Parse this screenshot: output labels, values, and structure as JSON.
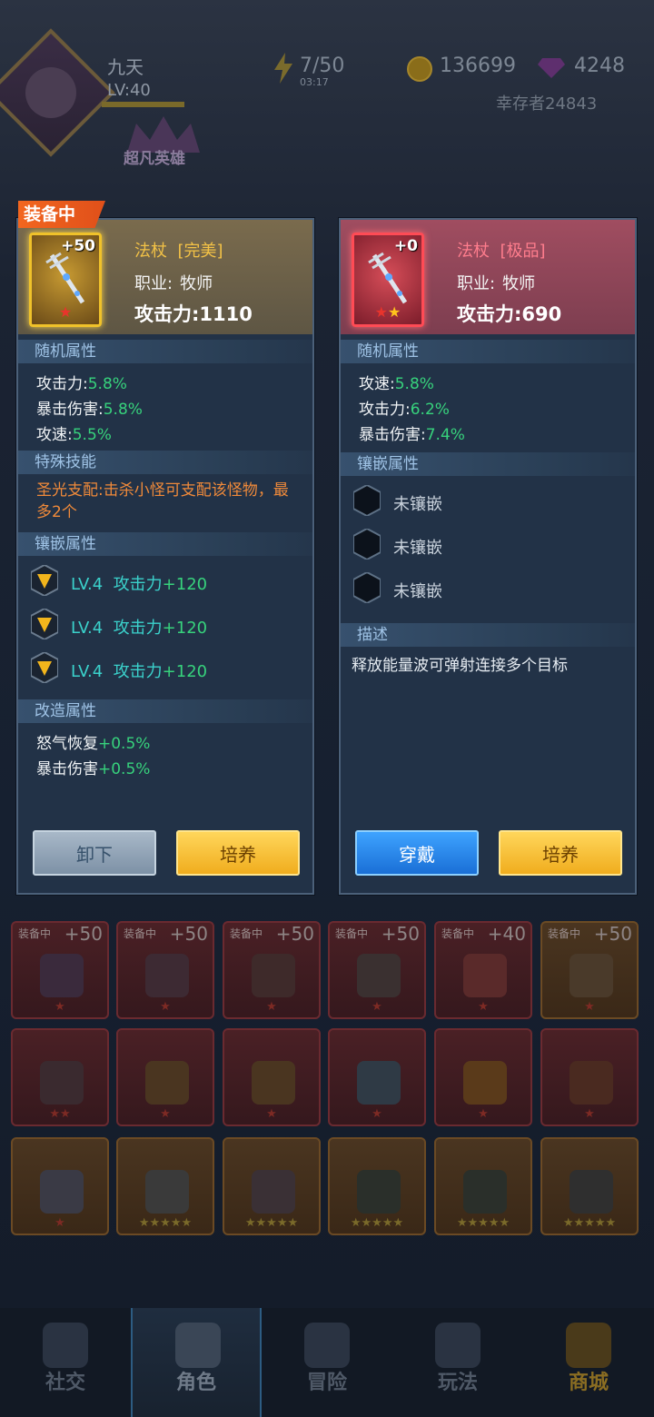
{
  "player": {
    "name": "九天",
    "level": "LV:40",
    "level_progress": 0.55,
    "survivor_id": "幸存者24843",
    "hero_rank": "超凡英雄"
  },
  "resources": {
    "energy": "7/50",
    "energy_timer": "03:17",
    "gold": "136699",
    "gems": "4248"
  },
  "equipped_badge": "装备中",
  "left_item": {
    "plus": "+50",
    "name": "法杖",
    "quality": "[完美]",
    "class_label": "职业:",
    "class_value": "牧师",
    "attack": "攻击力:1110",
    "stars": 1,
    "random_title": "随机属性",
    "random_attrs": [
      {
        "label": "攻击力:",
        "value": "5.8%"
      },
      {
        "label": "暴击伤害:",
        "value": "5.8%"
      },
      {
        "label": "攻速:",
        "value": "5.5%"
      }
    ],
    "skill_title": "特殊技能",
    "skill_text": "圣光支配:击杀小怪可支配该怪物，最多2个",
    "socket_title": "镶嵌属性",
    "sockets": [
      {
        "level": "LV.4",
        "stat": "攻击力",
        "value": "+120"
      },
      {
        "level": "LV.4",
        "stat": "攻击力",
        "value": "+120"
      },
      {
        "level": "LV.4",
        "stat": "攻击力",
        "value": "+120"
      }
    ],
    "refine_title": "改造属性",
    "refine_attrs": [
      {
        "label": "怒气恢复",
        "value": "+0.5%"
      },
      {
        "label": "暴击伤害",
        "value": "+0.5%"
      }
    ],
    "btn_unequip": "卸下",
    "btn_train": "培养"
  },
  "right_item": {
    "plus": "+0",
    "name": "法杖",
    "quality": "[极品]",
    "class_label": "职业:",
    "class_value": "牧师",
    "attack": "攻击力:690",
    "stars": 2,
    "random_title": "随机属性",
    "random_attrs": [
      {
        "label": "攻速:",
        "value": "5.8%"
      },
      {
        "label": "攻击力:",
        "value": "6.2%"
      },
      {
        "label": "暴击伤害:",
        "value": "7.4%"
      }
    ],
    "socket_title": "镶嵌属性",
    "empty_sockets": [
      "未镶嵌",
      "未镶嵌",
      "未镶嵌"
    ],
    "desc_title": "描述",
    "desc_text": "释放能量波可弹射连接多个目标",
    "btn_equip": "穿戴",
    "btn_train": "培养"
  },
  "inventory_row1": [
    {
      "tag": "装备中",
      "lv": "+50"
    },
    {
      "tag": "装备中",
      "lv": "+50"
    },
    {
      "tag": "装备中",
      "lv": "+50"
    },
    {
      "tag": "装备中",
      "lv": "+50"
    },
    {
      "tag": "装备中",
      "lv": "+40"
    },
    {
      "tag": "装备中",
      "lv": "+50"
    }
  ],
  "nav": {
    "social": "社交",
    "role": "角色",
    "adventure": "冒险",
    "play": "玩法",
    "shop": "商城"
  }
}
